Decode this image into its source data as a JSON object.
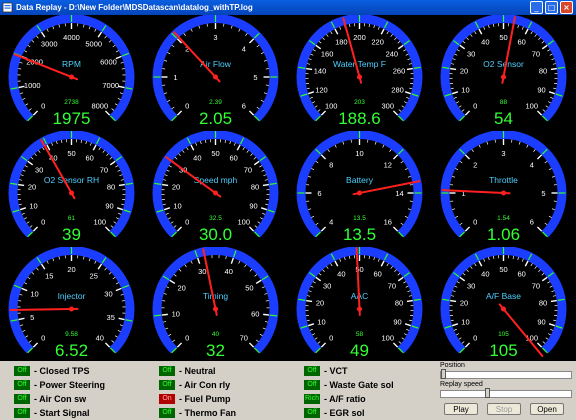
{
  "window": {
    "title": "Data Replay - D:\\New Folder\\MDSDatascan\\datalog_withTP.log"
  },
  "gauges": [
    {
      "label": "RPM",
      "min": 0,
      "max": 8000,
      "ticks": [
        "0",
        "1000",
        "2000",
        "3000",
        "4000",
        "5000",
        "6000",
        "7000",
        "8000"
      ],
      "small": "2738",
      "value": "1975",
      "needle": 1975
    },
    {
      "label": "Air Flow",
      "min": 0,
      "max": 6,
      "ticks": [
        "0",
        "1",
        "2",
        "3",
        "4",
        "5",
        "6"
      ],
      "small": "2.39",
      "value": "2.05",
      "needle": 2.05
    },
    {
      "label": "Water Temp F",
      "min": 100,
      "max": 300,
      "ticks": [
        "100",
        "120",
        "140",
        "160",
        "180",
        "200",
        "220",
        "240",
        "260",
        "280",
        "300"
      ],
      "small": "203",
      "value": "188.6",
      "needle": 188.6
    },
    {
      "label": "O2 Sensor",
      "min": 0,
      "max": 100,
      "ticks": [
        "0",
        "10",
        "20",
        "30",
        "40",
        "50",
        "60",
        "70",
        "80",
        "90",
        "100"
      ],
      "small": "88",
      "value": "54",
      "needle": 54
    },
    {
      "label": "O2 Sensor RH",
      "min": 0,
      "max": 100,
      "ticks": [
        "0",
        "10",
        "20",
        "30",
        "40",
        "50",
        "60",
        "70",
        "80",
        "90",
        "100"
      ],
      "small": "61",
      "value": "39",
      "needle": 39
    },
    {
      "label": "Speed mph",
      "min": 0,
      "max": 100,
      "ticks": [
        "0",
        "10",
        "20",
        "30",
        "40",
        "50",
        "60",
        "70",
        "80",
        "90",
        "100"
      ],
      "small": "32.5",
      "value": "30.0",
      "needle": 30.0
    },
    {
      "label": "Battery",
      "min": 4,
      "max": 16,
      "ticks": [
        "4",
        "6",
        "8",
        "10",
        "12",
        "14",
        "16"
      ],
      "small": "13.5",
      "value": "13.5",
      "needle": 13.5
    },
    {
      "label": "Throttle",
      "min": 0,
      "max": 6,
      "ticks": [
        "0",
        "1",
        "2",
        "3",
        "4",
        "5",
        "6"
      ],
      "small": "1.54",
      "value": "1.06",
      "needle": 1.06
    },
    {
      "label": "Injector",
      "min": 0,
      "max": 40,
      "ticks": [
        "0",
        "5",
        "10",
        "15",
        "20",
        "25",
        "30",
        "35",
        "40"
      ],
      "small": "9.58",
      "value": "6.52",
      "needle": 6.52
    },
    {
      "label": "Timing",
      "min": 0,
      "max": 70,
      "ticks": [
        "0",
        "10",
        "20",
        "30",
        "40",
        "50",
        "60",
        "70"
      ],
      "small": "40",
      "value": "32",
      "needle": 32
    },
    {
      "label": "AAC",
      "min": 0,
      "max": 100,
      "ticks": [
        "0",
        "10",
        "20",
        "30",
        "40",
        "50",
        "60",
        "70",
        "80",
        "90",
        "100"
      ],
      "small": "58",
      "value": "49",
      "needle": 49
    },
    {
      "label": "A/F Base",
      "min": 0,
      "max": 100,
      "ticks": [
        "0",
        "10",
        "20",
        "30",
        "40",
        "50",
        "60",
        "70",
        "80",
        "90",
        "100"
      ],
      "small": "105",
      "value": "105",
      "needle": 105
    }
  ],
  "indicators": [
    {
      "state": "Off",
      "label": "- Closed TPS",
      "on": false
    },
    {
      "state": "Off",
      "label": "- Power Steering",
      "on": false
    },
    {
      "state": "Off",
      "label": "- Air Con sw",
      "on": false
    },
    {
      "state": "Off",
      "label": "- Start Signal",
      "on": false
    },
    {
      "state": "Off",
      "label": "- Neutral",
      "on": false
    },
    {
      "state": "Off",
      "label": "- Air Con rly",
      "on": false
    },
    {
      "state": "On",
      "label": "- Fuel Pump",
      "on": true
    },
    {
      "state": "Off",
      "label": "- Thermo Fan",
      "on": false
    },
    {
      "state": "Off",
      "label": "- VCT",
      "on": false
    },
    {
      "state": "Off",
      "label": "- Waste Gate sol",
      "on": false
    },
    {
      "state": "Rich",
      "label": "- A/F ratio",
      "on": false
    },
    {
      "state": "Off",
      "label": "- EGR sol",
      "on": false
    }
  ],
  "controls": {
    "position_label": "Position",
    "position_value": 0,
    "replay_speed_label": "Replay speed",
    "speed_value": 0.35,
    "play_label": "Play",
    "stop_label": "Stop",
    "open_label": "Open"
  },
  "colors": {
    "dial": "#1a3dff",
    "needle": "#ff2020",
    "digital": "#33ff33",
    "label": "#4fd0ff",
    "green_tick": "#2aff2a"
  }
}
